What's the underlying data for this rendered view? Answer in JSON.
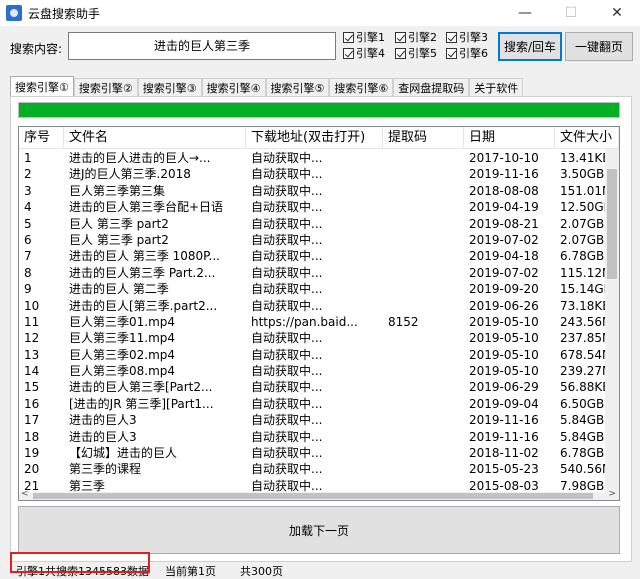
{
  "window": {
    "title": "云盘搜索助手",
    "minimize": "—",
    "maximize": "☐",
    "close": "✕"
  },
  "search": {
    "label": "搜索内容:",
    "value": "进击的巨人第三季",
    "engines": [
      {
        "label": "引擎1",
        "checked": true
      },
      {
        "label": "引擎2",
        "checked": true
      },
      {
        "label": "引擎3",
        "checked": true
      },
      {
        "label": "引擎4",
        "checked": true
      },
      {
        "label": "引擎5",
        "checked": true
      },
      {
        "label": "引擎6",
        "checked": true
      }
    ],
    "search_button": "搜索/回车",
    "flip_button": "一键翻页"
  },
  "tabs": [
    "搜索引擎①",
    "搜索引擎②",
    "搜索引擎③",
    "搜索引擎④",
    "搜索引擎⑤",
    "搜索引擎⑥",
    "查网盘提取码",
    "关于软件"
  ],
  "progress_fraction": 1.0,
  "progress_color": "#06b025",
  "table": {
    "columns": [
      "序号",
      "文件名",
      "下载地址(双击打开)",
      "提取码",
      "日期",
      "文件大小"
    ],
    "rows": [
      [
        "1",
        "进击的巨人进击的巨人→...",
        "自动获取中...",
        "",
        "2017-10-10",
        "13.41KB"
      ],
      [
        "2",
        "进J的巨人第三季.2018",
        "自动获取中...",
        "",
        "2019-11-16",
        "3.50GB"
      ],
      [
        "3",
        "巨人第三季第三集",
        "自动获取中...",
        "",
        "2018-08-08",
        "151.01M"
      ],
      [
        "4",
        "进击的巨人第三季台配+日语",
        "自动获取中...",
        "",
        "2019-04-19",
        "12.50GB"
      ],
      [
        "5",
        "巨人 第三季 part2",
        "自动获取中...",
        "",
        "2019-08-21",
        "2.07GB"
      ],
      [
        "6",
        "巨人 第三季 part2",
        "自动获取中...",
        "",
        "2019-07-02",
        "2.07GB"
      ],
      [
        "7",
        "进击的巨人 第三季 1080P...",
        "自动获取中...",
        "",
        "2019-04-18",
        "6.78GB"
      ],
      [
        "8",
        "进击的巨人第三季 Part.2...",
        "自动获取中...",
        "",
        "2019-07-02",
        "115.12M"
      ],
      [
        "9",
        "进击的巨人 第二季",
        "自动获取中...",
        "",
        "2019-09-20",
        "15.14GB"
      ],
      [
        "10",
        "进击的巨人[第三季.part2...",
        "自动获取中...",
        "",
        "2019-06-26",
        "73.18KB"
      ],
      [
        "11",
        "巨人第三季01.mp4",
        "https://pan.baid...",
        "8152",
        "2019-05-10",
        "243.56M"
      ],
      [
        "12",
        "巨人第三季11.mp4",
        "自动获取中...",
        "",
        "2019-05-10",
        "237.85M"
      ],
      [
        "13",
        "巨人第三季02.mp4",
        "自动获取中...",
        "",
        "2019-05-10",
        "678.54M"
      ],
      [
        "14",
        "巨人第三季08.mp4",
        "自动获取中...",
        "",
        "2019-05-10",
        "239.27M"
      ],
      [
        "15",
        "进击的巨人第三季[Part2...",
        "自动获取中...",
        "",
        "2019-06-29",
        "56.88KB"
      ],
      [
        "16",
        "[进击的JR 第三季][Part1...",
        "自动获取中...",
        "",
        "2019-09-04",
        "6.50GB"
      ],
      [
        "17",
        "进击的巨人3",
        "自动获取中...",
        "",
        "2019-11-16",
        "5.84GB"
      ],
      [
        "18",
        "进击的巨人3",
        "自动获取中...",
        "",
        "2019-11-16",
        "5.84GB"
      ],
      [
        "19",
        "【幻城】进击的巨人",
        "自动获取中...",
        "",
        "2018-11-02",
        "6.78GB"
      ],
      [
        "20",
        "第三季的课程",
        "自动获取中...",
        "",
        "2015-05-23",
        "540.56M"
      ],
      [
        "21",
        "第三季",
        "自动获取中...",
        "",
        "2015-08-03",
        "7.98GB"
      ]
    ]
  },
  "load_more": "加载下一页",
  "status": {
    "total": "引擎1共搜索1345583数据",
    "current_page": "当前第1页",
    "page_count": "共300页"
  },
  "highlight_color": "#e02020"
}
